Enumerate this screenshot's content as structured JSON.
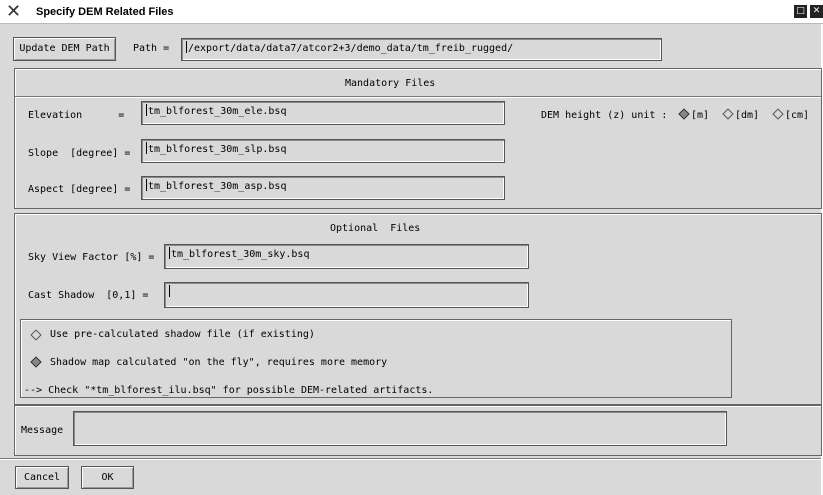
{
  "window": {
    "title": "Specify DEM Related Files",
    "titlebar_buttons": [
      "maximize-icon",
      "close-icon"
    ]
  },
  "path_row": {
    "update_button": "Update DEM Path",
    "path_label": "Path =",
    "path_value": "/export/data/data7/atcor2+3/demo_data/tm_freib_rugged/"
  },
  "mandatory": {
    "title": "Mandatory Files",
    "elevation": {
      "label": "Elevation      =",
      "value": "tm_blforest_30m_ele.bsq"
    },
    "slope": {
      "label": "Slope  [degree] =",
      "value": "tm_blforest_30m_slp.bsq"
    },
    "aspect": {
      "label": "Aspect [degree] =",
      "value": "tm_blforest_30m_asp.bsq"
    },
    "unit_label": "DEM height (z) unit :",
    "units": [
      {
        "label": "[m]",
        "selected": true
      },
      {
        "label": "[dm]",
        "selected": false
      },
      {
        "label": "[cm]",
        "selected": false
      }
    ]
  },
  "optional": {
    "title": "Optional  Files",
    "sky": {
      "label": "Sky View Factor [%] =",
      "value": "tm_blforest_30m_sky.bsq"
    },
    "cast": {
      "label": "Cast Shadow  [0,1] =",
      "value": ""
    },
    "shadow_options": [
      {
        "label": "Use pre-calculated shadow file (if existing)",
        "selected": false
      },
      {
        "label": "Shadow map calculated \"on the fly\", requires more memory",
        "selected": true
      }
    ],
    "note": "--> Check \"*tm_blforest_ilu.bsq\" for possible DEM-related artifacts."
  },
  "message": {
    "label": "Message",
    "value": ""
  },
  "footer": {
    "cancel": "Cancel",
    "ok": "OK"
  }
}
